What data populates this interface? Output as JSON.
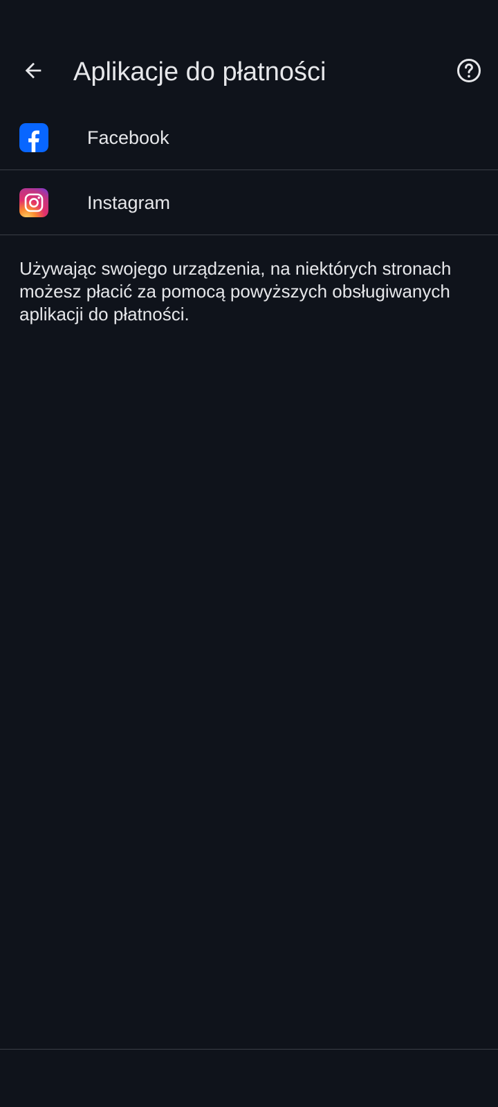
{
  "header": {
    "title": "Aplikacje do płatności",
    "back_icon": "arrow-back-icon",
    "help_icon": "help-circle-icon"
  },
  "apps": [
    {
      "label": "Facebook",
      "icon": "facebook-icon",
      "brand_color": "#0866ff"
    },
    {
      "label": "Instagram",
      "icon": "instagram-icon",
      "brand_color": "#e1306c"
    }
  ],
  "description": "Używając swojego urządzenia, na niektórych stronach możesz płacić za pomocą powyższych obsługiwanych aplikacji do płatności.",
  "colors": {
    "background": "#0f131b",
    "text": "#e6e7ea",
    "divider": "#3b3f47"
  }
}
